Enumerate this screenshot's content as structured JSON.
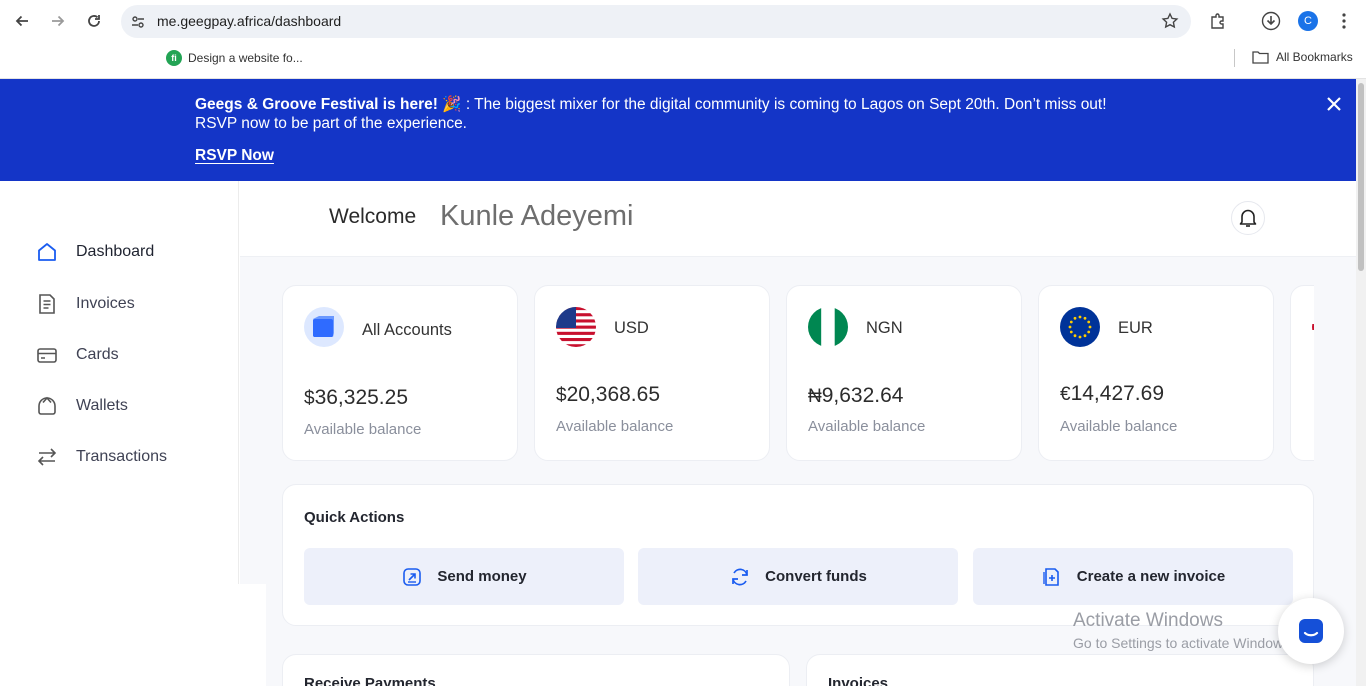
{
  "browser": {
    "url": "me.geegpay.africa/dashboard",
    "bookmark": "Design a website fo...",
    "bookmark_favicon": "fi",
    "all_bookmarks": "All Bookmarks",
    "profile_initial": "C"
  },
  "banner": {
    "headline": "Geegs & Groove Festival is here! 🎉",
    "line1_rest": " : The biggest mixer for the digital community is coming to Lagos on Sept 20th. Don’t miss out!",
    "line2": "RSVP now to be part of the experience.",
    "cta": "RSVP Now",
    "bg_color": "#1435c7"
  },
  "sidebar": {
    "items": [
      {
        "label": "Dashboard",
        "icon": "home-icon"
      },
      {
        "label": "Invoices",
        "icon": "invoice-icon"
      },
      {
        "label": "Cards",
        "icon": "card-icon"
      },
      {
        "label": "Wallets",
        "icon": "wallet-icon"
      },
      {
        "label": "Transactions",
        "icon": "transfer-icon"
      }
    ]
  },
  "header": {
    "welcome": "Welcome",
    "user_name": "Kunle Adeyemi"
  },
  "accounts": [
    {
      "name": "All Accounts",
      "currency_symbol": "$",
      "amount": "36,325.25",
      "sub": "Available balance"
    },
    {
      "name": "USD",
      "currency_symbol": "$",
      "amount": "20,368.65",
      "sub": "Available balance"
    },
    {
      "name": "NGN",
      "currency_symbol": "₦",
      "amount": "9,632.64",
      "sub": "Available balance"
    },
    {
      "name": "EUR",
      "currency_symbol": "€",
      "amount": "14,427.69",
      "sub": "Available balance"
    }
  ],
  "quick_actions": {
    "title": "Quick Actions",
    "buttons": [
      {
        "label": "Send money",
        "icon": "send-icon"
      },
      {
        "label": "Convert funds",
        "icon": "convert-icon"
      },
      {
        "label": "Create a new invoice",
        "icon": "new-invoice-icon"
      }
    ]
  },
  "panels": {
    "receive_payments": "Receive Payments",
    "invoices": "Invoices"
  },
  "windows_watermark": {
    "line1": "Activate Windows",
    "line2": "Go to Settings to activate Windows."
  },
  "colors": {
    "accent": "#1435c7",
    "quick_action_bg": "#edf0fa",
    "chat_icon": "#1550d8"
  }
}
